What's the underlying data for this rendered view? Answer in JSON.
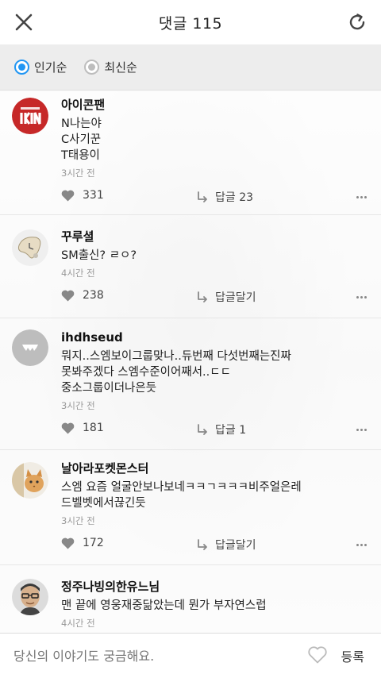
{
  "header": {
    "title": "댓글 115"
  },
  "sort": {
    "options": [
      {
        "label": "인기순",
        "selected": true
      },
      {
        "label": "최신순",
        "selected": false
      }
    ]
  },
  "comments": [
    {
      "nick": "아이콘팬",
      "text": "N나는야\nC사기꾼\nT태용이",
      "time": "3시간 전",
      "likes": "331",
      "reply": "답글 23",
      "avatar": "ikon-logo-avatar"
    },
    {
      "nick": "꾸루셜",
      "text": "SM출신? ㄹㅇ?",
      "time": "4시간 전",
      "likes": "238",
      "reply": "답글달기",
      "avatar": "melting-clock-avatar"
    },
    {
      "nick": "ihdhseud",
      "text": "뭐지..스엠보이그룹맞나..듀번째 다섯번째는진짜\n못봐주겠다 스엠수준이어째서..ㄷㄷ\n중소그룹이더나은듯",
      "time": "3시간 전",
      "likes": "181",
      "reply": "답글 1",
      "avatar": "default-avatar"
    },
    {
      "nick": "날아라포켓몬스터",
      "text": "스엠 요즘 얼굴안보나보네ㅋㅋㄱㅋㅋㅋ비주얼은레\n드벨벳에서끊긴듯",
      "time": "3시간 전",
      "likes": "172",
      "reply": "답글달기",
      "avatar": "cat-photo-avatar"
    },
    {
      "nick": "정주나빙의한유느님",
      "text": "맨 끝에 영웅재중닮았는데  뭔가 부자연스럽",
      "time": "4시간 전",
      "likes": "",
      "reply": "",
      "avatar": "man-glasses-avatar"
    }
  ],
  "input": {
    "placeholder": "당신의 이야기도 궁금해요.",
    "submit": "등록"
  },
  "colors": {
    "accent": "#2196f3",
    "avatar_red": "#c62828"
  }
}
